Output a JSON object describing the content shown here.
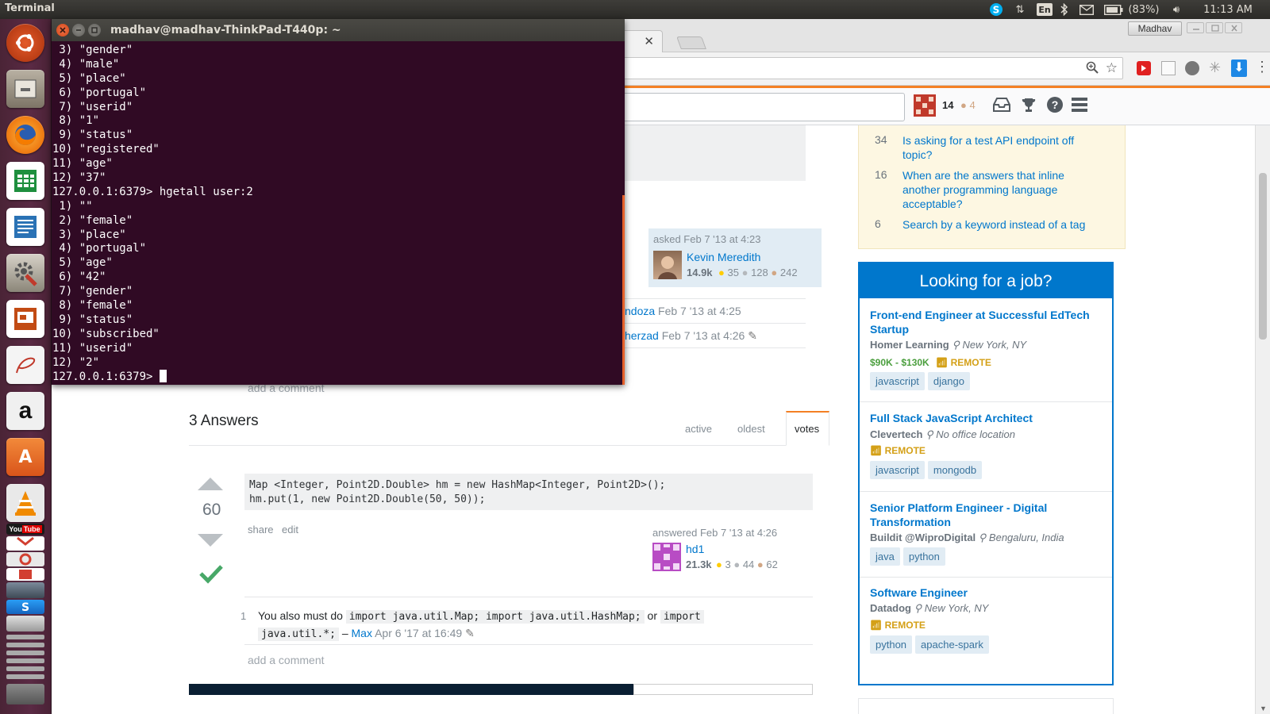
{
  "top_panel": {
    "app_title": "Terminal",
    "keyboard_layout": "En",
    "battery": "(83%)",
    "clock": "11:13 AM"
  },
  "launcher": {
    "items": [
      {
        "name": "ubuntu-dash",
        "color": "#dd4814"
      },
      {
        "name": "files",
        "color": "#8a7f6e"
      },
      {
        "name": "firefox",
        "color": "#e66000"
      },
      {
        "name": "libreoffice-calc",
        "color": "#1e8f3e"
      },
      {
        "name": "libreoffice-writer",
        "color": "#2a72b5"
      },
      {
        "name": "system-settings",
        "color": "#9e3c3c"
      },
      {
        "name": "libreoffice-impress",
        "color": "#c24b14"
      },
      {
        "name": "pdf-viewer",
        "color": "#e8e8e8"
      },
      {
        "name": "amazon",
        "color": "#1f1f1f"
      },
      {
        "name": "software-center",
        "color": "#e5621a"
      },
      {
        "name": "vlc",
        "color": "#f08a00"
      }
    ]
  },
  "browser": {
    "user_badge": "Madhav",
    "so": {
      "reputation": "14",
      "bronze": "4",
      "linked": [
        {
          "votes": "34",
          "title": "Is asking for a test API endpoint off topic?"
        },
        {
          "votes": "16",
          "title": "When are the answers that inline another programming language acceptable?"
        },
        {
          "votes": "6",
          "title": "Search by a keyword instead of a tag"
        }
      ],
      "question_owner": {
        "asked": "asked Feb 7 '13 at 4:23",
        "name": "Kevin Meredith",
        "rep": "14.9k",
        "gold": "35",
        "silver": "128",
        "bronze": "242"
      },
      "comment1": {
        "user_tail": "ndoza",
        "time": "Feb 7 '13 at 4:25"
      },
      "comment2": {
        "user_tail": "herzad",
        "time": "Feb 7 '13 at 4:26"
      },
      "add_comment": "add a comment",
      "answers_header": "3 Answers",
      "sort_tabs": [
        "active",
        "oldest",
        "votes"
      ],
      "answer": {
        "score": "60",
        "code_line1": "Map <Integer, Point2D.Double> hm = new HashMap<Integer, Point2D>();",
        "code_line2": "hm.put(1, new Point2D.Double(50, 50));",
        "share": "share",
        "edit": "edit",
        "answered": "answered Feb 7 '13 at 4:26",
        "user": "hd1",
        "rep": "21.3k",
        "gold": "3",
        "silver": "44",
        "bronze": "62"
      },
      "answer_comment": {
        "score": "1",
        "pre": "You also must do",
        "code1": "import java.util.Map; import java.util.HashMap;",
        "or": "or",
        "code2a": "import",
        "code2b": "java.util.*;",
        "dash": "–",
        "user": "Max",
        "time": "Apr 6 '17 at 16:49"
      },
      "jobs": {
        "header": "Looking for a job?",
        "items": [
          {
            "title": "Front-end Engineer at Successful EdTech Startup",
            "company": "Homer Learning",
            "location": "New York, NY",
            "salary": "$90K - $130K",
            "remote": "REMOTE",
            "tags": [
              "javascript",
              "django"
            ]
          },
          {
            "title": "Full Stack JavaScript Architect",
            "company": "Clevertech",
            "location": "No office location",
            "salary": "",
            "remote": "REMOTE",
            "tags": [
              "javascript",
              "mongodb"
            ]
          },
          {
            "title": "Senior Platform Engineer - Digital Transformation",
            "company": "Buildit @WiproDigital",
            "location": "Bengaluru, India",
            "salary": "",
            "remote": "",
            "tags": [
              "java",
              "python"
            ]
          },
          {
            "title": "Software Engineer",
            "company": "Datadog",
            "location": "New York, NY",
            "salary": "",
            "remote": "REMOTE",
            "tags": [
              "python",
              "apache-spark"
            ]
          }
        ]
      }
    }
  },
  "terminal": {
    "title": "madhav@madhav-ThinkPad-T440p: ~",
    "lines": [
      " 3) \"gender\"",
      " 4) \"male\"",
      " 5) \"place\"",
      " 6) \"portugal\"",
      " 7) \"userid\"",
      " 8) \"1\"",
      " 9) \"status\"",
      "10) \"registered\"",
      "11) \"age\"",
      "12) \"37\"",
      "127.0.0.1:6379> hgetall user:2",
      " 1) \"\"",
      " 2) \"female\"",
      " 3) \"place\"",
      " 4) \"portugal\"",
      " 5) \"age\"",
      " 6) \"42\"",
      " 7) \"gender\"",
      " 8) \"female\"",
      " 9) \"status\"",
      "10) \"subscribed\"",
      "11) \"userid\"",
      "12) \"2\""
    ],
    "prompt": "127.0.0.1:6379> "
  }
}
